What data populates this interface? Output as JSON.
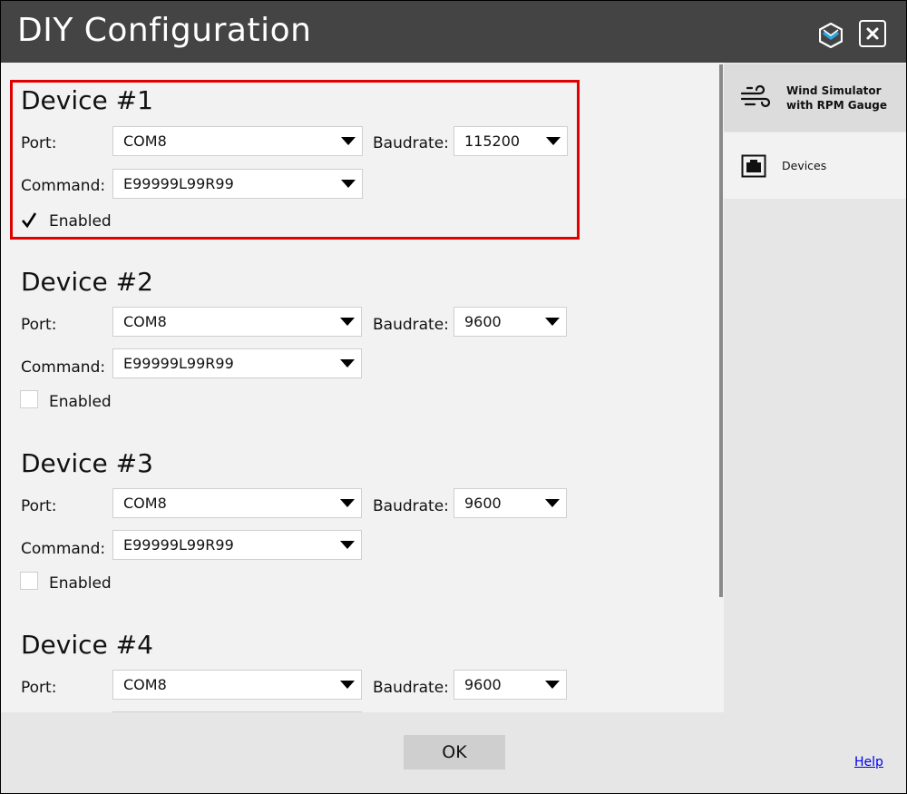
{
  "window": {
    "title": "DIY Configuration"
  },
  "sidebar": {
    "items": [
      {
        "label_line1": "Wind Simulator",
        "label_line2": "with RPM Gauge",
        "icon": "wind-icon"
      },
      {
        "label": "Devices",
        "icon": "device-icon"
      }
    ],
    "selected": "Devices"
  },
  "labels": {
    "port": "Port:",
    "baudrate": "Baudrate:",
    "command": "Command:",
    "enabled": "Enabled"
  },
  "devices": [
    {
      "title": "Device #1",
      "port": "COM8",
      "baudrate": "115200",
      "command": "E99999L99R99",
      "enabled": true
    },
    {
      "title": "Device #2",
      "port": "COM8",
      "baudrate": "9600",
      "command": "E99999L99R99",
      "enabled": false
    },
    {
      "title": "Device #3",
      "port": "COM8",
      "baudrate": "9600",
      "command": "E99999L99R99",
      "enabled": false
    },
    {
      "title": "Device #4",
      "port": "COM8",
      "baudrate": "9600",
      "command": "",
      "enabled": false
    }
  ],
  "footer": {
    "ok_label": "OK",
    "help_label": "Help"
  },
  "colors": {
    "titlebar": "#444444",
    "highlight": "#e00000",
    "logo_accent": "#2aa6e0",
    "link": "#0000ee"
  }
}
